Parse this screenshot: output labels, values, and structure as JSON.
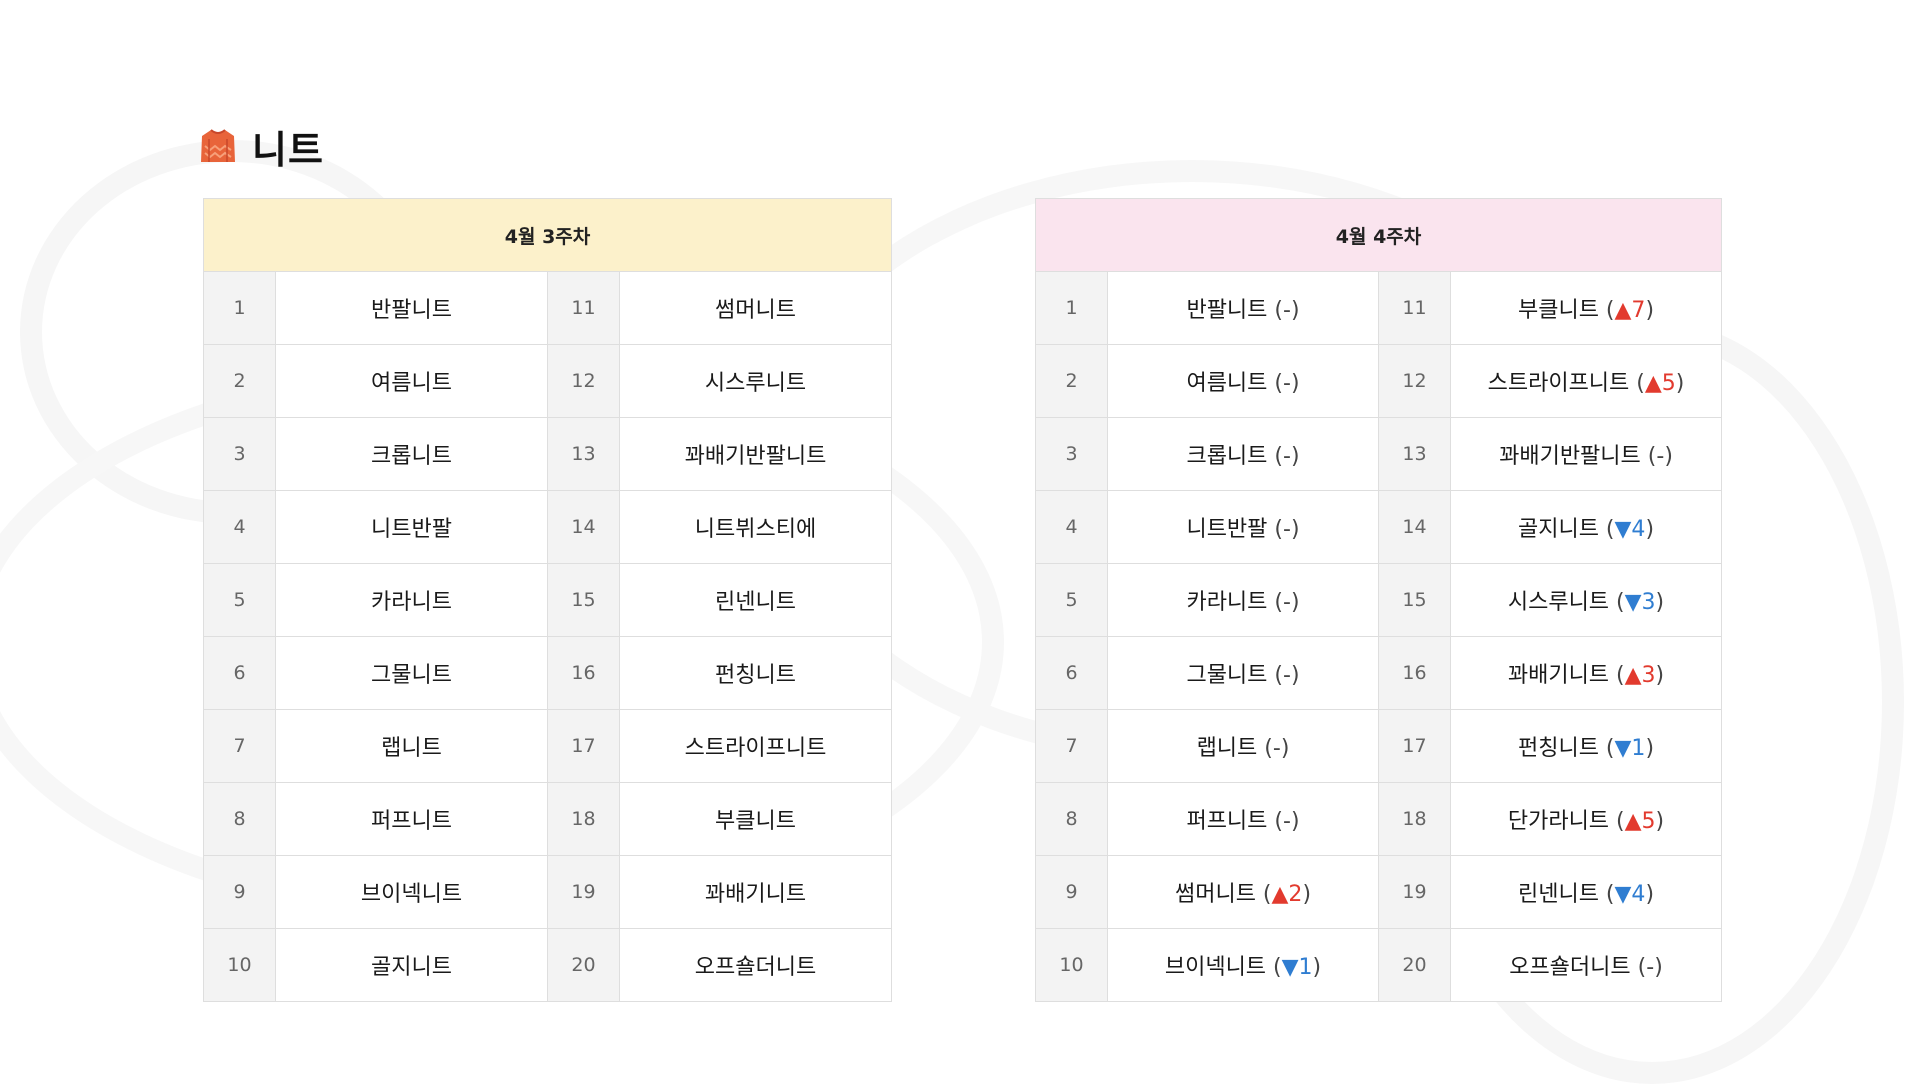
{
  "header": {
    "title": "니트",
    "icon": "sweater-icon",
    "icon_color": "#e8643a"
  },
  "weeks": [
    {
      "label": "4월 3주차",
      "header_color": "#fcf1cb",
      "items": [
        {
          "rank": "1",
          "name": "반팔니트"
        },
        {
          "rank": "2",
          "name": "여름니트"
        },
        {
          "rank": "3",
          "name": "크롭니트"
        },
        {
          "rank": "4",
          "name": "니트반팔"
        },
        {
          "rank": "5",
          "name": "카라니트"
        },
        {
          "rank": "6",
          "name": "그물니트"
        },
        {
          "rank": "7",
          "name": "랩니트"
        },
        {
          "rank": "8",
          "name": "퍼프니트"
        },
        {
          "rank": "9",
          "name": "브이넥니트"
        },
        {
          "rank": "10",
          "name": "골지니트"
        },
        {
          "rank": "11",
          "name": "썸머니트"
        },
        {
          "rank": "12",
          "name": "시스루니트"
        },
        {
          "rank": "13",
          "name": "꽈배기반팔니트"
        },
        {
          "rank": "14",
          "name": "니트뷔스티에"
        },
        {
          "rank": "15",
          "name": "린넨니트"
        },
        {
          "rank": "16",
          "name": "펀칭니트"
        },
        {
          "rank": "17",
          "name": "스트라이프니트"
        },
        {
          "rank": "18",
          "name": "부클니트"
        },
        {
          "rank": "19",
          "name": "꽈배기니트"
        },
        {
          "rank": "20",
          "name": "오프숄더니트"
        }
      ]
    },
    {
      "label": "4월 4주차",
      "header_color": "#fae4ee",
      "items": [
        {
          "rank": "1",
          "name": "반팔니트",
          "change": "-"
        },
        {
          "rank": "2",
          "name": "여름니트",
          "change": "-"
        },
        {
          "rank": "3",
          "name": "크롭니트",
          "change": "-"
        },
        {
          "rank": "4",
          "name": "니트반팔",
          "change": "-"
        },
        {
          "rank": "5",
          "name": "카라니트",
          "change": "-"
        },
        {
          "rank": "6",
          "name": "그물니트",
          "change": "-"
        },
        {
          "rank": "7",
          "name": "랩니트",
          "change": "-"
        },
        {
          "rank": "8",
          "name": "퍼프니트",
          "change": "-"
        },
        {
          "rank": "9",
          "name": "썸머니트",
          "change": "▲2"
        },
        {
          "rank": "10",
          "name": "브이넥니트",
          "change": "▼1"
        },
        {
          "rank": "11",
          "name": "부클니트",
          "change": "▲7"
        },
        {
          "rank": "12",
          "name": "스트라이프니트",
          "change": "▲5"
        },
        {
          "rank": "13",
          "name": "꽈배기반팔니트",
          "change": "-"
        },
        {
          "rank": "14",
          "name": "골지니트",
          "change": "▼4"
        },
        {
          "rank": "15",
          "name": "시스루니트",
          "change": "▼3"
        },
        {
          "rank": "16",
          "name": "꽈배기니트",
          "change": "▲3"
        },
        {
          "rank": "17",
          "name": "펀칭니트",
          "change": "▼1"
        },
        {
          "rank": "18",
          "name": "단가라니트",
          "change": "▲5"
        },
        {
          "rank": "19",
          "name": "린넨니트",
          "change": "▼4"
        },
        {
          "rank": "20",
          "name": "오프숄더니트",
          "change": "-"
        }
      ]
    }
  ],
  "colors": {
    "up": "#e23a2e",
    "down": "#2f7dd1"
  }
}
